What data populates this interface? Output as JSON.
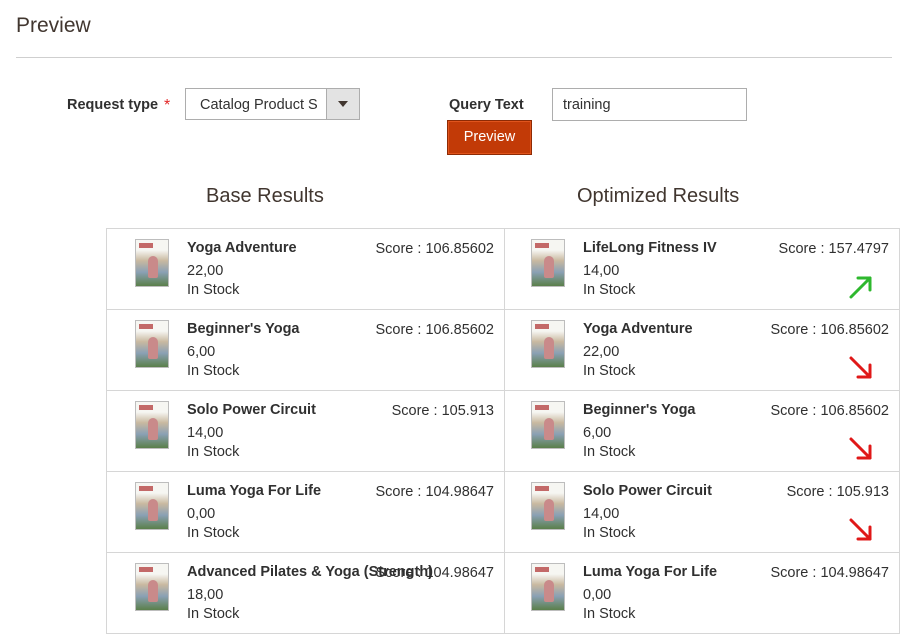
{
  "page": {
    "title": "Preview"
  },
  "form": {
    "request_type_label": "Request type",
    "required_mark": "*",
    "request_type_value": "Catalog Product S",
    "query_label": "Query Text",
    "query_value": "training",
    "preview_button": "Preview"
  },
  "base": {
    "title": "Base Results",
    "items": [
      {
        "name": "Yoga Adventure",
        "price": "22,00",
        "stock": "In Stock",
        "score": "Score : 106.85602"
      },
      {
        "name": "Beginner's Yoga",
        "price": "6,00",
        "stock": "In Stock",
        "score": "Score : 106.85602"
      },
      {
        "name": "Solo Power Circuit",
        "price": "14,00",
        "stock": "In Stock",
        "score": "Score : 105.913"
      },
      {
        "name": "Luma Yoga For Life",
        "price": "0,00",
        "stock": "In Stock",
        "score": "Score : 104.98647"
      },
      {
        "name": "Advanced Pilates & Yoga (Strength)",
        "price": "18,00",
        "stock": "In Stock",
        "score": "Score : 104.98647"
      }
    ]
  },
  "optimized": {
    "title": "Optimized Results",
    "items": [
      {
        "name": "LifeLong Fitness IV",
        "price": "14,00",
        "stock": "In Stock",
        "score": "Score : 157.4797",
        "trend": "up",
        "trend_icon": "arrow-up-right-icon",
        "trend_color": "#2eb82e"
      },
      {
        "name": "Yoga Adventure",
        "price": "22,00",
        "stock": "In Stock",
        "score": "Score : 106.85602",
        "trend": "down",
        "trend_icon": "arrow-down-right-icon",
        "trend_color": "#e01818"
      },
      {
        "name": "Beginner's Yoga",
        "price": "6,00",
        "stock": "In Stock",
        "score": "Score : 106.85602",
        "trend": "down",
        "trend_icon": "arrow-down-right-icon",
        "trend_color": "#e01818"
      },
      {
        "name": "Solo Power Circuit",
        "price": "14,00",
        "stock": "In Stock",
        "score": "Score : 105.913",
        "trend": "down",
        "trend_icon": "arrow-down-right-icon",
        "trend_color": "#e01818"
      },
      {
        "name": "Luma Yoga For Life",
        "price": "0,00",
        "stock": "In Stock",
        "score": "Score : 104.98647",
        "trend": "",
        "trend_icon": "",
        "trend_color": ""
      }
    ]
  },
  "colors": {
    "primary_button": "#c23a07",
    "up": "#2eb82e",
    "down": "#e01818"
  }
}
